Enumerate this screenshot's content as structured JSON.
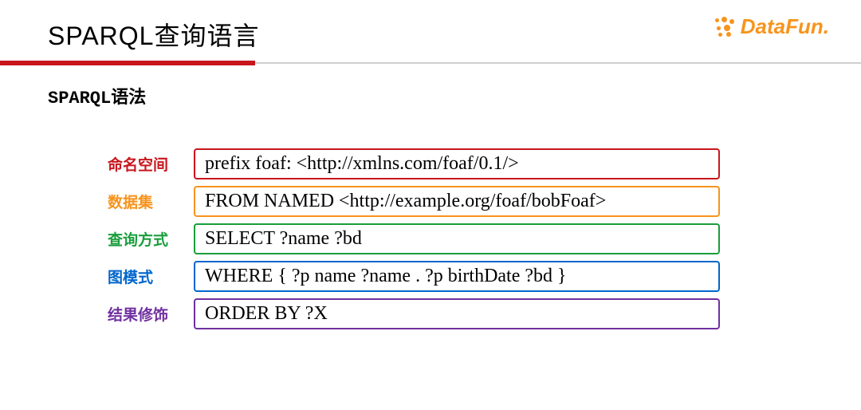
{
  "header": {
    "title": "SPARQL查询语言",
    "logo_text": "DataFun.",
    "subtitle": "SPARQL语法"
  },
  "rows": [
    {
      "label": "命名空间",
      "content": "prefix foaf: <http://xmlns.com/foaf/0.1/>",
      "color": "red"
    },
    {
      "label": "数据集",
      "content": "FROM NAMED <http://example.org/foaf/bobFoaf>",
      "color": "orange"
    },
    {
      "label": "查询方式",
      "content": "SELECT ?name ?bd",
      "color": "green"
    },
    {
      "label": "图模式",
      "content": "WHERE { ?p name ?name . ?p birthDate ?bd }",
      "color": "blue"
    },
    {
      "label": "结果修饰",
      "content": "ORDER BY ?X",
      "color": "purple"
    }
  ]
}
